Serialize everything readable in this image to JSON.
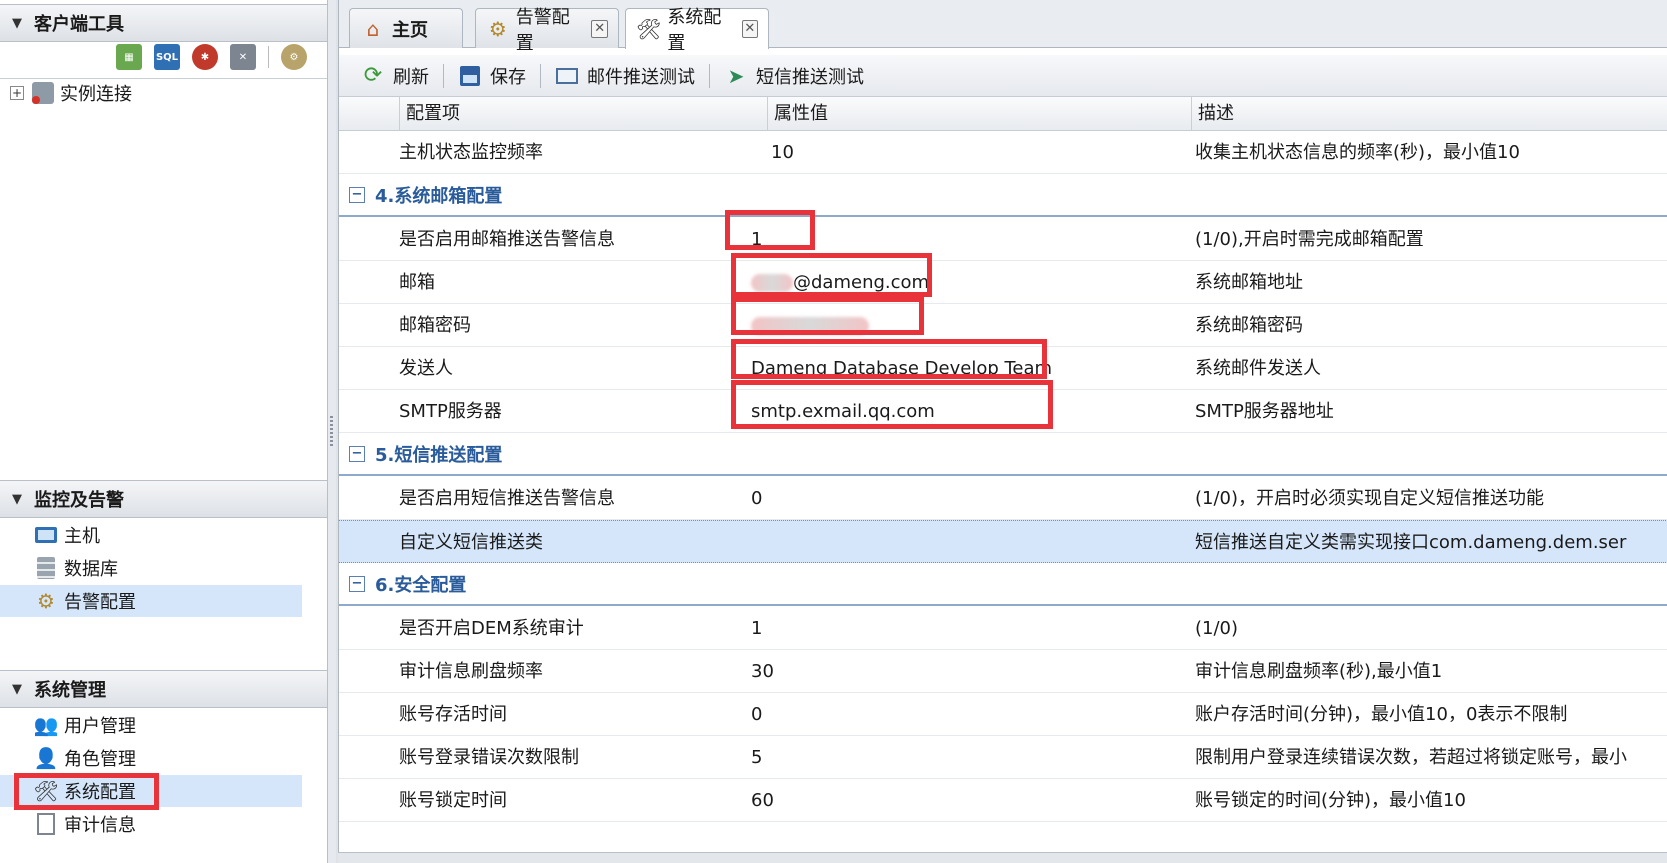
{
  "left": {
    "client_tools": {
      "title": "客户端工具",
      "toolbar_icons": [
        "grid-add-icon",
        "sql-icon",
        "bug-icon",
        "db-remove-icon",
        "gear-icon"
      ],
      "tree_item": "实例连接"
    },
    "monitor": {
      "title": "监控及告警",
      "items": [
        "主机",
        "数据库",
        "告警配置"
      ]
    },
    "system": {
      "title": "系统管理",
      "items": [
        "用户管理",
        "角色管理",
        "系统配置",
        "审计信息"
      ]
    }
  },
  "tabs": [
    "主页",
    "告警配置",
    "系统配置"
  ],
  "actions": [
    "刷新",
    "保存",
    "邮件推送测试",
    "短信推送测试"
  ],
  "grid": {
    "columns": [
      "配置项",
      "属性值",
      "描述"
    ],
    "top_row": {
      "name": "主机状态监控频率",
      "value": "10",
      "desc": "收集主机状态信息的频率(秒)，最小值10"
    },
    "group4": "4.系统邮箱配置",
    "g4_rows": [
      {
        "name": "是否启用邮箱推送告警信息",
        "value": "1",
        "desc": "(1/0),开启时需完成邮箱配置"
      },
      {
        "name": "邮箱",
        "value": "@dameng.com",
        "desc": "系统邮箱地址"
      },
      {
        "name": "邮箱密码",
        "value": "",
        "desc": "系统邮箱密码"
      },
      {
        "name": "发送人",
        "value": "Dameng Database Develop Team",
        "desc": "系统邮件发送人"
      },
      {
        "name": "SMTP服务器",
        "value": "smtp.exmail.qq.com",
        "desc": "SMTP服务器地址"
      }
    ],
    "group5": "5.短信推送配置",
    "g5_rows": [
      {
        "name": "是否启用短信推送告警信息",
        "value": "0",
        "desc": "(1/0)，开启时必须实现自定义短信推送功能"
      },
      {
        "name": "自定义短信推送类",
        "value": "",
        "desc": "短信推送自定义类需实现接口com.dameng.dem.ser"
      }
    ],
    "group6": "6.安全配置",
    "g6_rows": [
      {
        "name": "是否开启DEM系统审计",
        "value": "1",
        "desc": "(1/0)"
      },
      {
        "name": "审计信息刷盘频率",
        "value": "30",
        "desc": "审计信息刷盘频率(秒),最小值1"
      },
      {
        "name": "账号存活时间",
        "value": "0",
        "desc": "账户存活时间(分钟)，最小值10，0表示不限制"
      },
      {
        "name": "账号登录错误次数限制",
        "value": "5",
        "desc": "限制用户登录连续错误次数，若超过将锁定账号，最小"
      },
      {
        "name": "账号锁定时间",
        "value": "60",
        "desc": "账号锁定的时间(分钟)，最小值10"
      }
    ]
  },
  "colors": {
    "highlight": "#e8333a",
    "selected": "#d5e6fb",
    "group_text": "#2a5b9a"
  }
}
